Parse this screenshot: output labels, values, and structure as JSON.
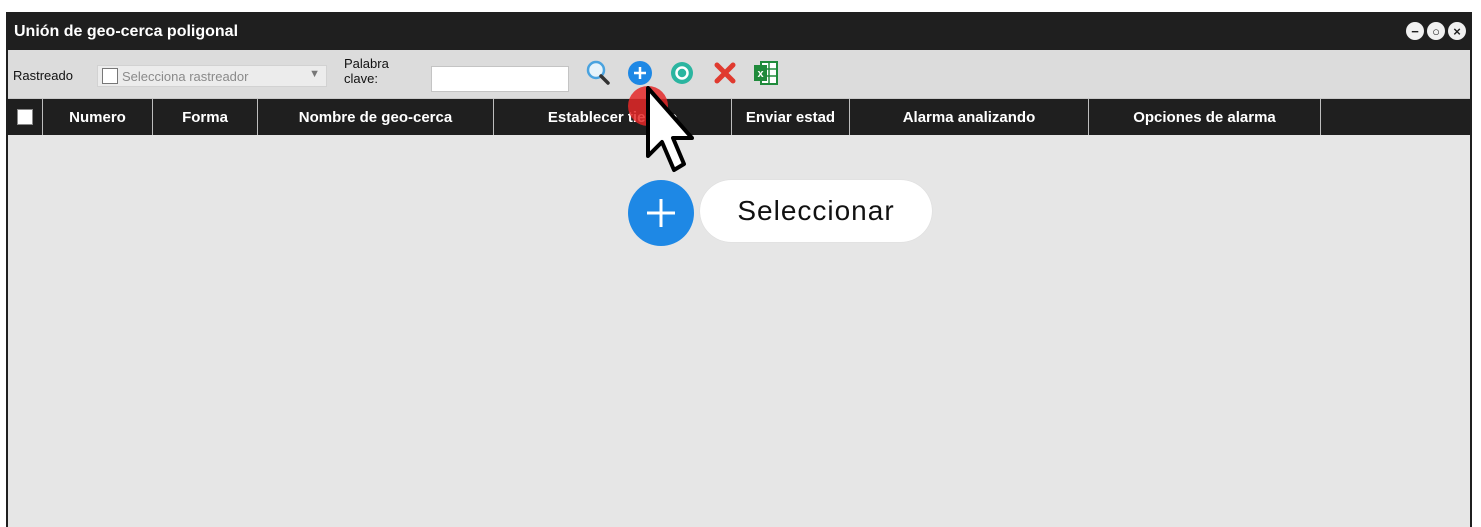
{
  "window": {
    "title": "Unión de geo-cerca poligonal",
    "controls": [
      "minimize",
      "maximize",
      "close"
    ]
  },
  "toolbar": {
    "tracker_label": "Rastreado",
    "tracker_select": {
      "selected": "Selecciona rastreador"
    },
    "keyword_label": "Palabra clave:",
    "keyword_input": {
      "value": "",
      "placeholder": ""
    },
    "tools": [
      {
        "name": "search-icon",
        "color": "#4aa3df"
      },
      {
        "name": "add-icon",
        "color": "#1e88e5"
      },
      {
        "name": "refresh-icon",
        "color": "#2bb5a0"
      },
      {
        "name": "delete-icon",
        "color": "#e03a2f"
      },
      {
        "name": "excel-icon",
        "color": "#1f8a3b"
      }
    ]
  },
  "table": {
    "columns": [
      "Numero",
      "Forma",
      "Nombre de geo-cerca",
      "Establecer tiempo",
      "Enviar estad",
      "Alarma analizando",
      "Opciones de alarma",
      ""
    ],
    "rows": []
  },
  "callout": {
    "text": "Seleccionar",
    "icon": "plus-icon",
    "color": "#1e88e5"
  }
}
